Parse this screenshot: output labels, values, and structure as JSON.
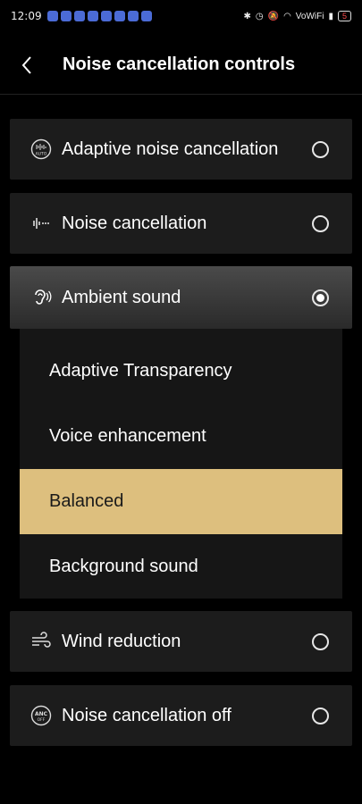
{
  "status_bar": {
    "time": "12:09",
    "network_label": "VoWiFi",
    "battery": "5"
  },
  "header": {
    "title": "Noise cancellation controls",
    "back_icon": "chevron-left-icon"
  },
  "options": [
    {
      "label": "Adaptive noise cancellation",
      "icon": "adaptive-anc-icon",
      "selected": false
    },
    {
      "label": "Noise cancellation",
      "icon": "noise-cancellation-icon",
      "selected": false
    },
    {
      "label": "Ambient sound",
      "icon": "ambient-sound-icon",
      "selected": true
    },
    {
      "label": "Wind reduction",
      "icon": "wind-icon",
      "selected": false
    },
    {
      "label": "Noise cancellation off",
      "icon": "anc-off-icon",
      "selected": false
    }
  ],
  "ambient_modes": [
    {
      "label": "Adaptive Transparency",
      "active": false
    },
    {
      "label": "Voice enhancement",
      "active": false
    },
    {
      "label": "Balanced",
      "active": true
    },
    {
      "label": "Background sound",
      "active": false
    }
  ],
  "colors": {
    "background": "#000000",
    "card": "#1c1c1c",
    "active_mode": "#ddbf7e"
  }
}
